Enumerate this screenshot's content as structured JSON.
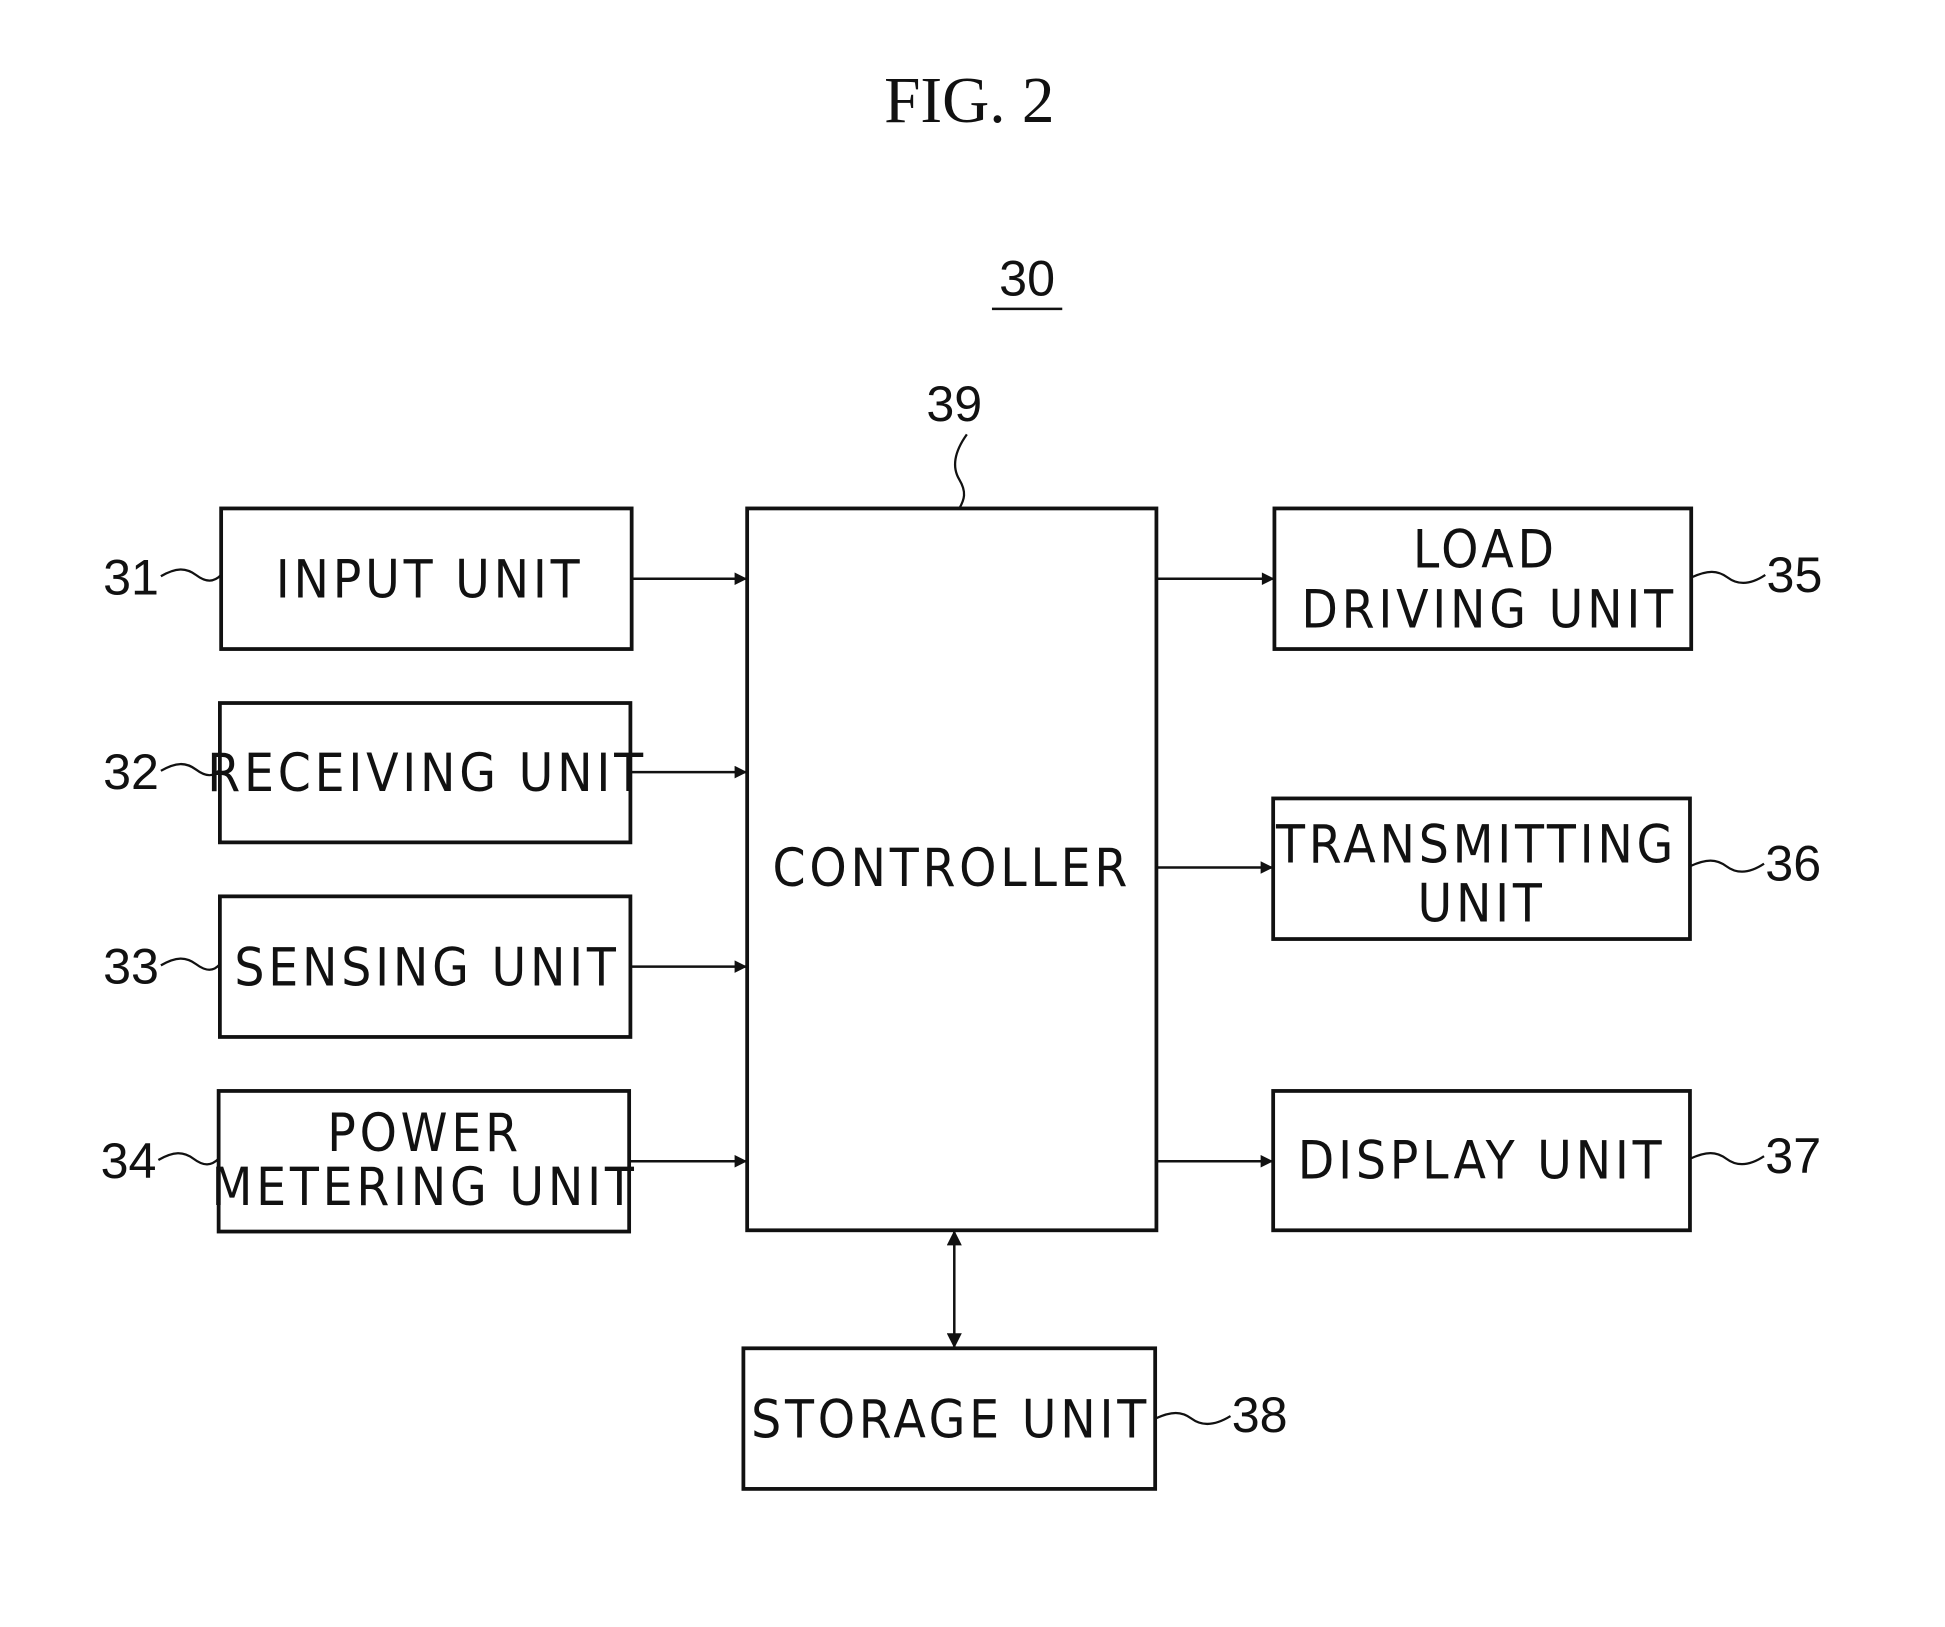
{
  "figure": {
    "title": "FIG. 2",
    "system_ref": "30"
  },
  "controller": {
    "ref": "39",
    "label": "CONTROLLER"
  },
  "inputs": [
    {
      "ref": "31",
      "lines": [
        "INPUT UNIT"
      ]
    },
    {
      "ref": "32",
      "lines": [
        "RECEIVING UNIT"
      ]
    },
    {
      "ref": "33",
      "lines": [
        "SENSING UNIT"
      ]
    },
    {
      "ref": "34",
      "lines": [
        "POWER",
        "METERING UNIT"
      ]
    }
  ],
  "outputs": [
    {
      "ref": "35",
      "lines": [
        "LOAD",
        "DRIVING UNIT"
      ]
    },
    {
      "ref": "36",
      "lines": [
        "TRANSMITTING",
        "UNIT"
      ]
    },
    {
      "ref": "37",
      "lines": [
        "DISPLAY UNIT"
      ]
    }
  ],
  "storage": {
    "ref": "38",
    "label": "STORAGE UNIT"
  },
  "connections": [
    {
      "from": "31",
      "to": "39",
      "type": "arrow"
    },
    {
      "from": "32",
      "to": "39",
      "type": "arrow"
    },
    {
      "from": "33",
      "to": "39",
      "type": "arrow"
    },
    {
      "from": "34",
      "to": "39",
      "type": "arrow"
    },
    {
      "from": "39",
      "to": "35",
      "type": "arrow"
    },
    {
      "from": "39",
      "to": "36",
      "type": "arrow"
    },
    {
      "from": "39",
      "to": "37",
      "type": "arrow"
    },
    {
      "from": "39",
      "to": "38",
      "type": "bidirectional"
    }
  ]
}
